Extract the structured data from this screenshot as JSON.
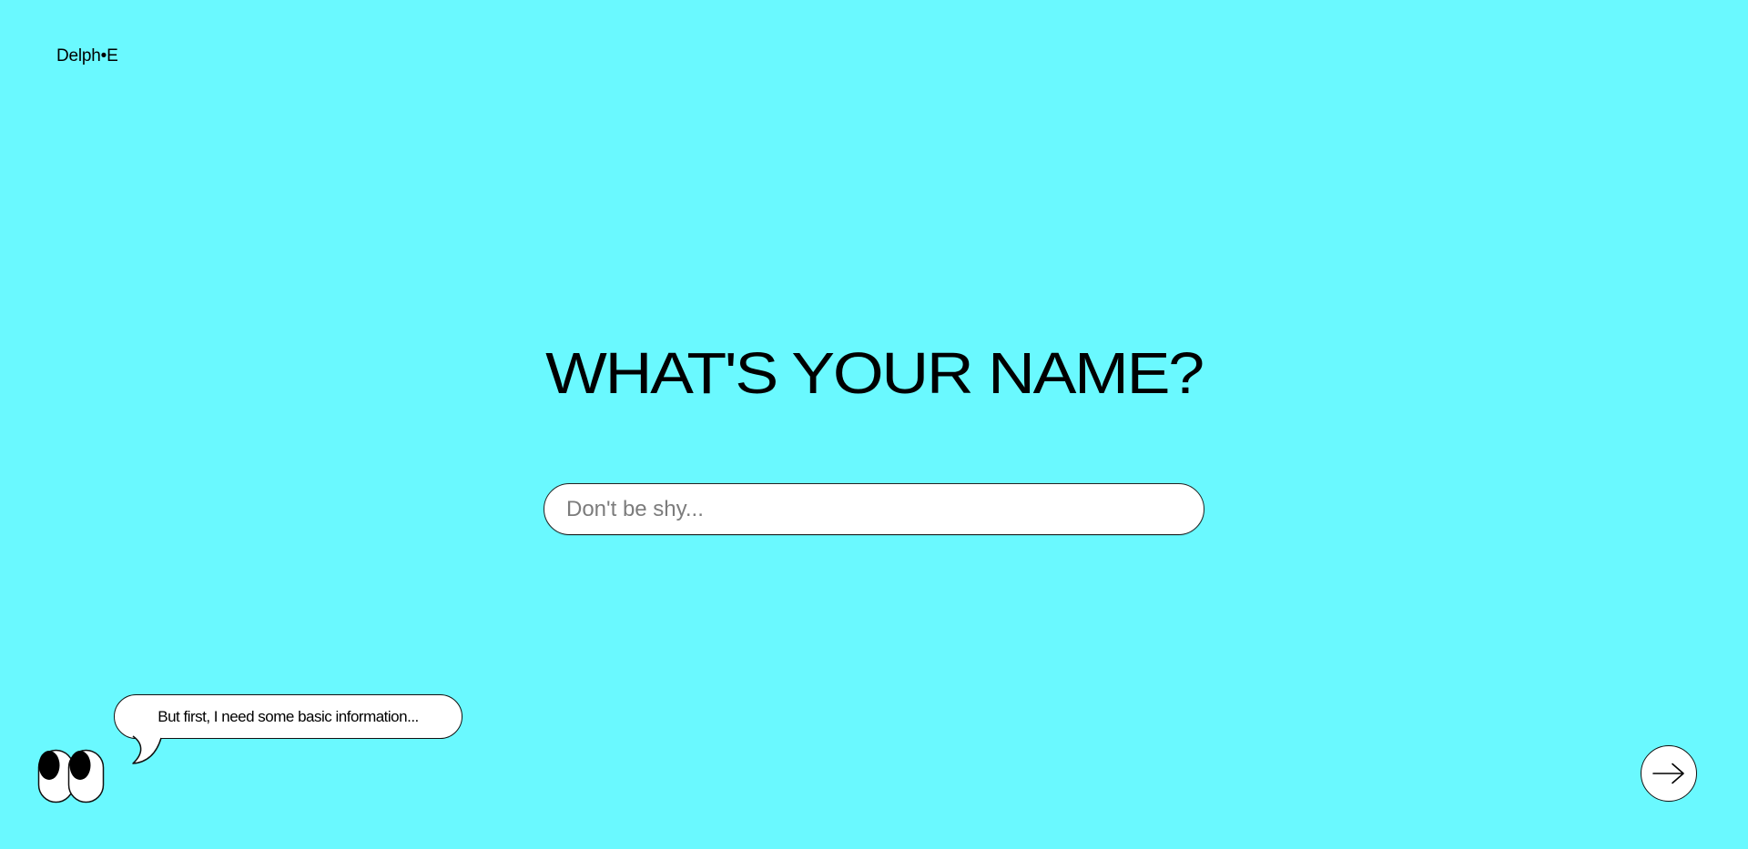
{
  "brand": {
    "logo_text": "Delph•E"
  },
  "prompt": {
    "question": "WHAT'S YOUR NAME?",
    "input_placeholder": "Don't be shy...",
    "input_value": ""
  },
  "assistant": {
    "bubble_text": "But first, I need some basic information...",
    "avatar_icon": "eyes-icon"
  },
  "navigation": {
    "next_icon": "arrow-right-icon"
  },
  "colors": {
    "background": "#6af9ff",
    "surface": "#ffffff",
    "text": "#000000",
    "placeholder": "#7c7c7c"
  }
}
